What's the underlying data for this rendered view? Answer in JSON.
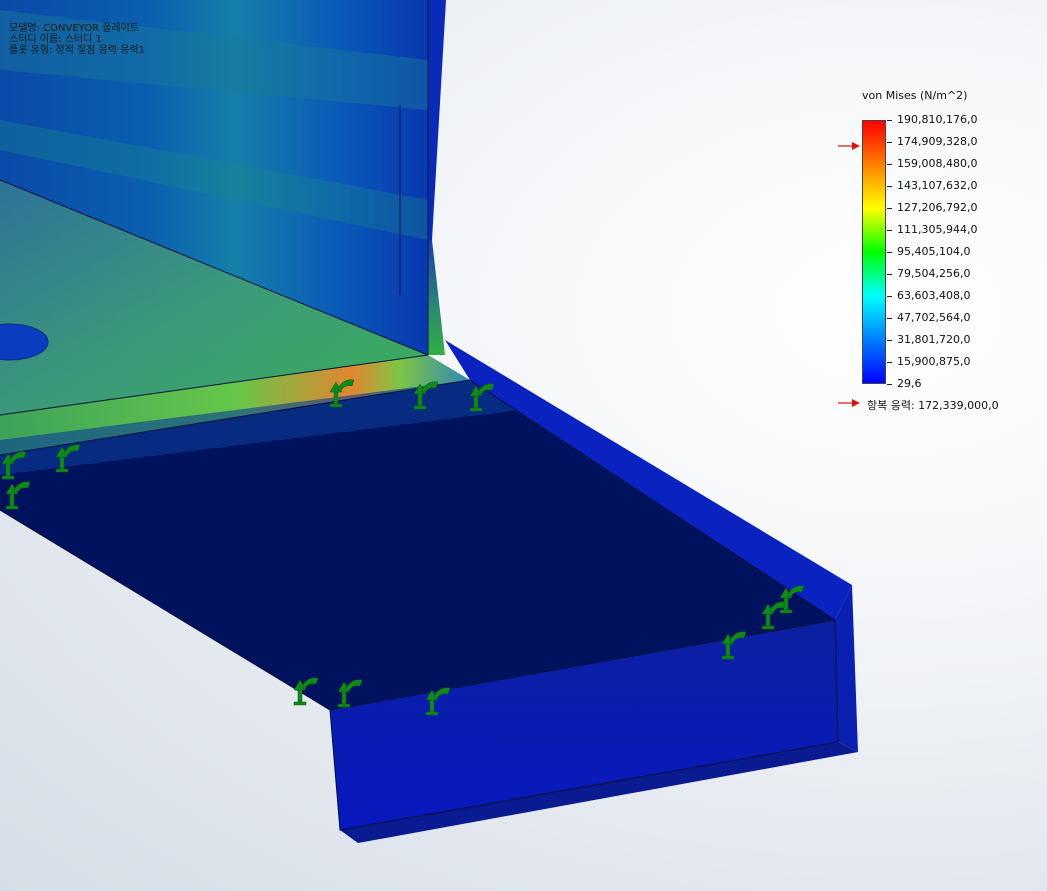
{
  "info": {
    "model_line": "모델명: CONVEYOR 플레이트",
    "study_line": "스터디 이름: 스터디 1",
    "plot_line": "플롯 유형: 정적 절점 응력 응력1"
  },
  "legend": {
    "title": "von Mises (N/m^2)",
    "ticks": [
      "190,810,176,0",
      "174,909,328,0",
      "159,008,480,0",
      "143,107,632,0",
      "127,206,792,0",
      "111,305,944,0",
      "95,405,104,0",
      "79,504,256,0",
      "63,603,408,0",
      "47,702,564,0",
      "31,801,720,0",
      "15,900,875,0",
      "29,6"
    ],
    "max_value": 190810176.0,
    "min_value": 29.6,
    "yield_label": "항복 응력: 172,339,000,0",
    "yield_value": 172339000.0,
    "colormap": [
      "#ff0000",
      "#ff8000",
      "#ffff00",
      "#00ff00",
      "#00ffff",
      "#0080ff",
      "#0000ff"
    ],
    "marker_color": "#e01010"
  },
  "colors": {
    "plate_top": "#00125e",
    "plate_side": "#0018b8",
    "fixture": "#0f8a1a"
  }
}
